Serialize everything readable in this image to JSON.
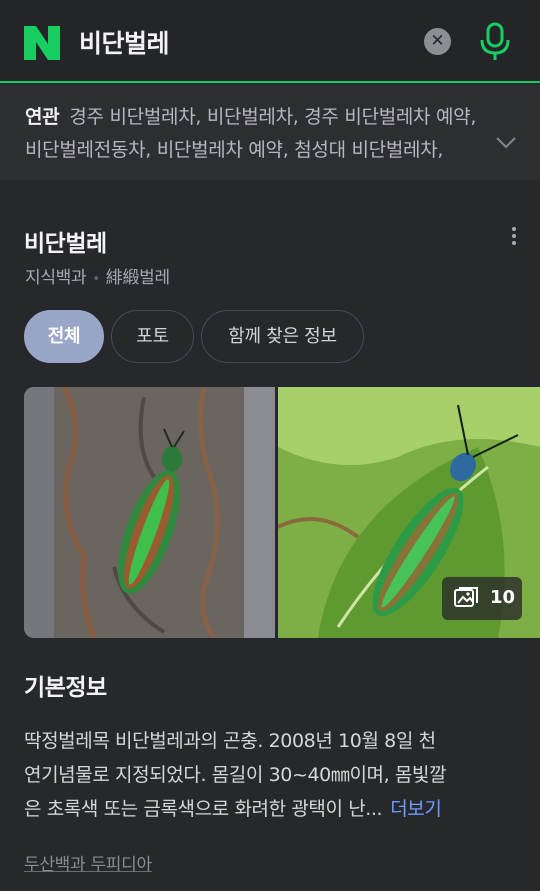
{
  "colors": {
    "brand_green": "#19ce60",
    "link_blue": "#6d9cff",
    "active_tab": "#9aa6c8",
    "background": "#27282c"
  },
  "search": {
    "query": "비단벌레",
    "brand_logo": "N",
    "clear_icon": "close-icon",
    "voice_icon": "microphone-icon"
  },
  "related": {
    "label": "연관",
    "line1": "경주 비단벌레차, 비단벌레차, 경주 비단벌레차 예약,",
    "line2": "비단벌레전동차, 비단벌레차 예약, 첨성대 비단벌레차,",
    "expand_icon": "chevron-down-icon"
  },
  "card": {
    "title": "비단벌레",
    "source": "지식백과",
    "hanja": "緋緞벌레",
    "tabs": [
      {
        "label": "전체",
        "active": true
      },
      {
        "label": "포토",
        "active": false
      },
      {
        "label": "함께 찾은 정보",
        "active": false
      }
    ],
    "photo_count": "10"
  },
  "basic_info": {
    "title": "기본정보",
    "description_line1": "딱정벌레목 비단벌레과의 곤충. 2008년 10월 8일 천",
    "description_line2": "연기념물로 지정되었다. 몸길이 30~40㎜이며, 몸빛깔",
    "description_line3": "은 초록색 또는 금록색으로 화려한 광택이 난...",
    "more_label": "더보기",
    "source_label": "두산백과 두피디아"
  }
}
